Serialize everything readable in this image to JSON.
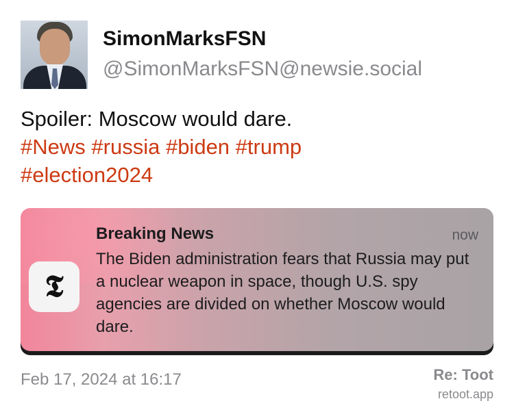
{
  "author": {
    "display_name": "SimonMarksFSN",
    "handle": "@SimonMarksFSN@newsie.social"
  },
  "post": {
    "text": "Spoiler: Moscow would dare.",
    "hashtags": [
      "#News",
      "#russia",
      "#biden",
      "#trump",
      "#election2024"
    ]
  },
  "attachment": {
    "app_icon": "nyt-logo-icon",
    "icon_glyph": "𝕿",
    "title": "Breaking News",
    "time": "now",
    "body": "The Biden administration fears that Russia may put a nuclear weapon in space, though U.S. spy agencies are divided on whether Moscow would dare."
  },
  "footer": {
    "date": "Feb 17, 2024 at 16:17",
    "brand_title": "Re: Toot",
    "brand_site": "retoot.app"
  },
  "colors": {
    "hashtag": "#cc3a12",
    "muted": "#8a8a8e"
  }
}
